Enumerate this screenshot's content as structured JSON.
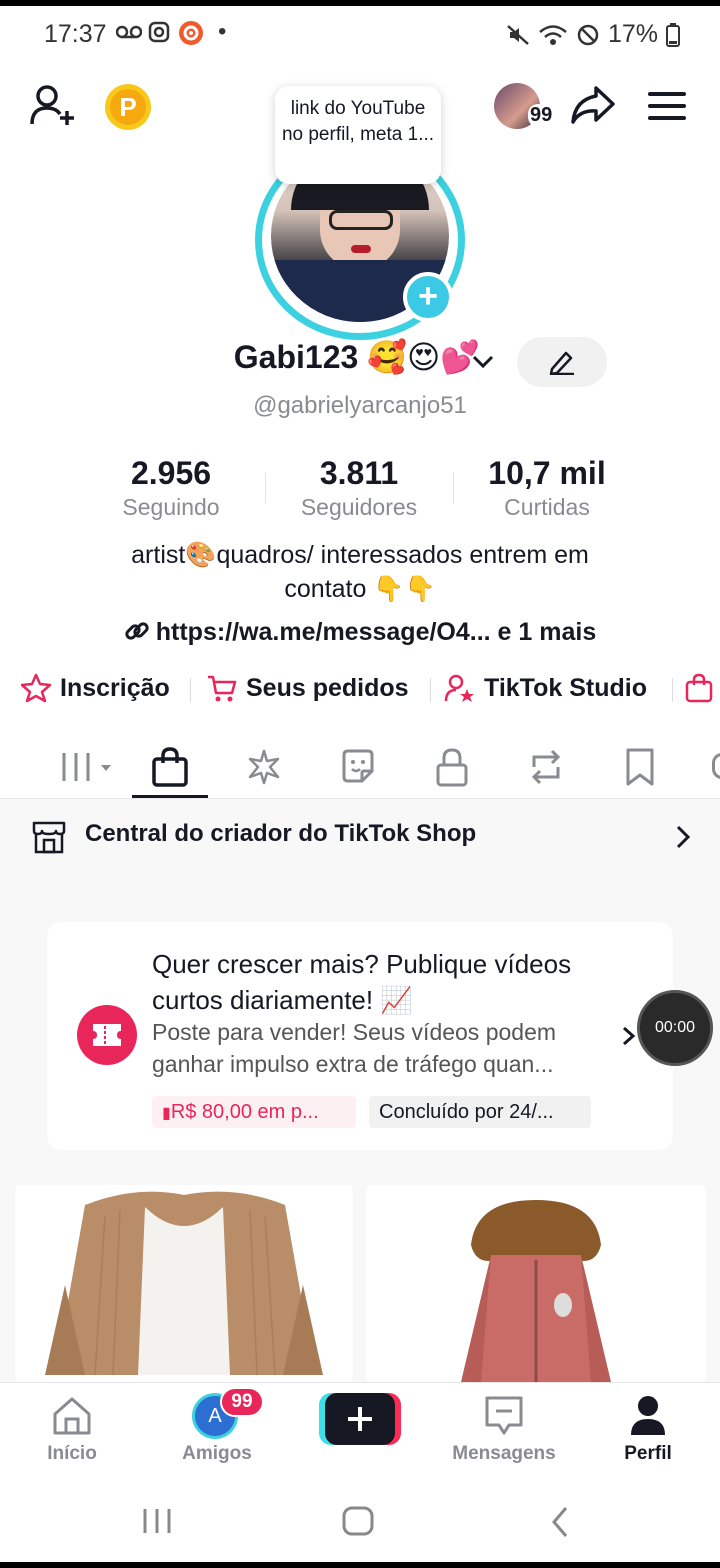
{
  "status_bar": {
    "time": "17:37",
    "dot": "•",
    "battery": "17%"
  },
  "profile": {
    "tooltip": "link do YouTube no perfil, meta 1...",
    "display_name": "Gabi123 🥰😍💕",
    "handle": "@gabrielyarcanjo51",
    "friend_badge_count": "99",
    "stats": [
      {
        "value": "2.956",
        "label": "Seguindo"
      },
      {
        "value": "3.811",
        "label": "Seguidores"
      },
      {
        "value": "10,7 mil",
        "label": "Curtidas"
      }
    ],
    "bio_line1": "artist🎨quadros/ interessados entrem em",
    "bio_line2": "contato 👇👇",
    "link": "https://wa.me/message/O4... e 1 mais"
  },
  "quick_links": [
    {
      "label": "Inscrição",
      "icon": "star-icon"
    },
    {
      "label": "Seus pedidos",
      "icon": "cart-icon"
    },
    {
      "label": "TikTok Studio",
      "icon": "person-star-icon"
    }
  ],
  "tabs": [
    {
      "name": "videos-grid",
      "icon": "grid-icon"
    },
    {
      "name": "shop",
      "icon": "shopping-bag-icon",
      "active": true
    },
    {
      "name": "effects",
      "icon": "sparkle-icon"
    },
    {
      "name": "stickers",
      "icon": "sticker-icon"
    },
    {
      "name": "private",
      "icon": "lock-icon"
    },
    {
      "name": "reposts",
      "icon": "repost-icon"
    },
    {
      "name": "saved",
      "icon": "bookmark-icon"
    }
  ],
  "shop": {
    "center_title": "Central do criador do TikTok Shop",
    "card": {
      "title": "Quer crescer mais? Publique vídeos curtos diariamente! 📈",
      "body_line1": "Poste para vender! Seus vídeos podem",
      "body_line2": "ganhar impulso extra de tráfego quan...",
      "pill_reward": "R$ 80,00 em p...",
      "pill_deadline": "Concluído por 24/..."
    },
    "timer": "00:00"
  },
  "bottom_nav": [
    {
      "label": "Início",
      "icon": "home-icon"
    },
    {
      "label": "Amigos",
      "icon": "friends-avatar",
      "badge": "99",
      "avatar_letter": "A"
    },
    {
      "label": "",
      "icon": "create-plus-icon"
    },
    {
      "label": "Mensagens",
      "icon": "message-icon"
    },
    {
      "label": "Perfil",
      "icon": "profile-icon",
      "active": true
    }
  ],
  "colors": {
    "accent_pink": "#e8265a",
    "teal": "#3cd1e0",
    "text_primary": "#161823",
    "text_secondary": "#8a8b91"
  }
}
